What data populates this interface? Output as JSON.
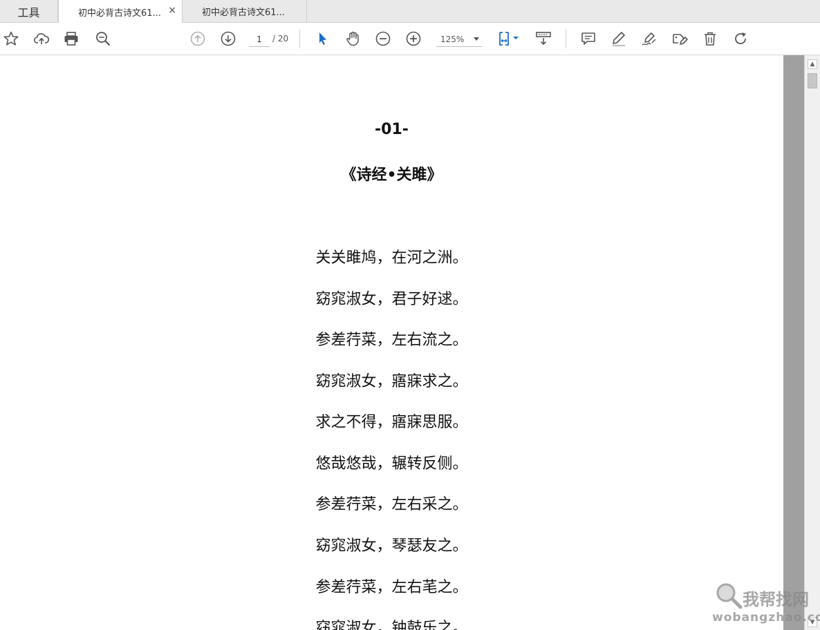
{
  "tabs": {
    "tools_label": "工具",
    "doc1_label": "初中必背古诗文61...",
    "doc2_label": "初中必背古诗文61...",
    "close_glyph": "×"
  },
  "toolbar": {
    "current_page": "1",
    "total_pages": "/ 20",
    "zoom": "125%",
    "icons": [
      "star-icon",
      "cloud-upload-icon",
      "print-icon",
      "zoom-search-icon",
      "page-up-icon",
      "page-down-icon",
      "select-cursor-icon",
      "hand-icon",
      "zoom-out-icon",
      "zoom-in-icon",
      "fit-page-icon",
      "scroll-mode-icon",
      "comment-icon",
      "highlight-icon",
      "sign-icon",
      "fill-sign-icon",
      "delete-icon",
      "rotate-icon"
    ],
    "accent_color": "#1a6fc2"
  },
  "document": {
    "poem_number": "-01-",
    "poem_title": "《诗经•关雎》",
    "lines": [
      "关关雎鸠，在河之洲。",
      "窈窕淑女，君子好逑。",
      "参差荇菜，左右流之。",
      "窈窕淑女，寤寐求之。",
      "求之不得，寤寐思服。",
      "悠哉悠哉，辗转反侧。",
      "参差荇菜，左右采之。",
      "窈窕淑女，琴瑟友之。",
      "参差荇菜，左右芼之。",
      "窈窕淑女，钟鼓乐之。"
    ]
  },
  "watermark": {
    "cn": "我帮找网",
    "en": "wobangzhao.com"
  }
}
